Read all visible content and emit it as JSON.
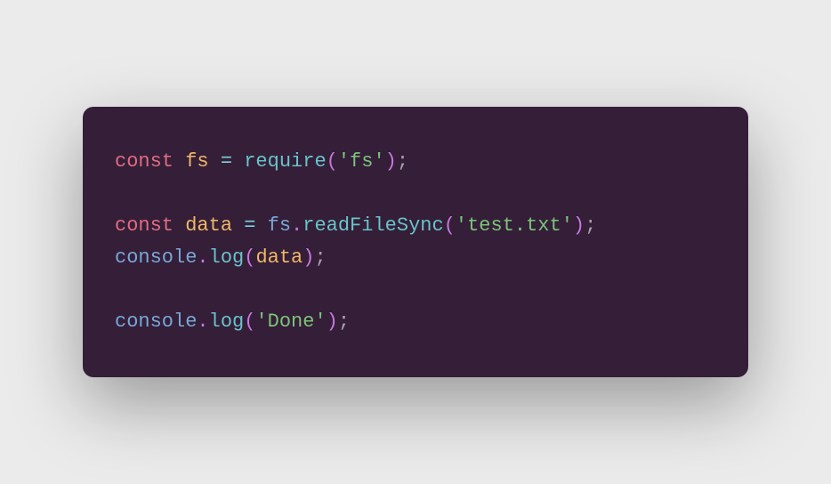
{
  "code": {
    "line1": {
      "const": "const",
      "sp1": " ",
      "var": "fs",
      "sp2": " ",
      "eq": "=",
      "sp3": " ",
      "func": "require",
      "lp": "(",
      "str": "'fs'",
      "rp": ")",
      "semi": ";"
    },
    "line3": {
      "const": "const",
      "sp1": " ",
      "var": "data",
      "sp2": " ",
      "eq": "=",
      "sp3": " ",
      "obj": "fs",
      "dot": ".",
      "method": "readFileSync",
      "lp": "(",
      "str": "'test.txt'",
      "rp": ")",
      "semi": ";"
    },
    "line4": {
      "obj": "console",
      "dot": ".",
      "method": "log",
      "lp": "(",
      "arg": "data",
      "rp": ")",
      "semi": ";"
    },
    "line6": {
      "obj": "console",
      "dot": ".",
      "method": "log",
      "lp": "(",
      "str": "'Done'",
      "rp": ")",
      "semi": ";"
    }
  }
}
